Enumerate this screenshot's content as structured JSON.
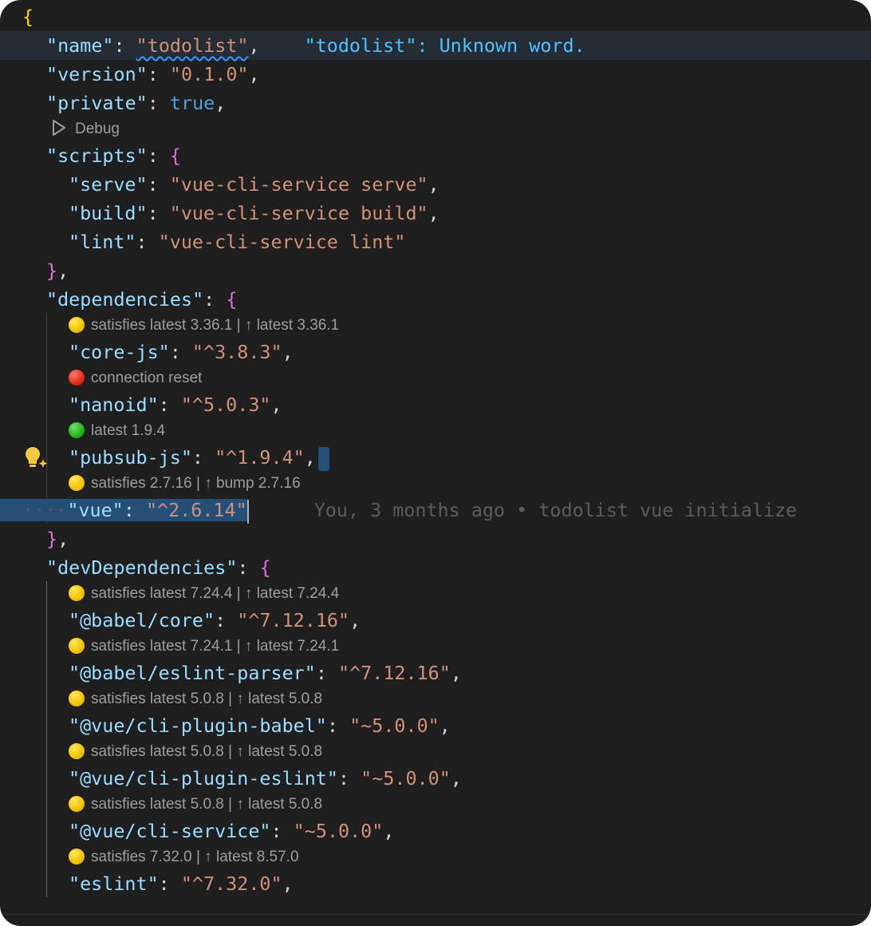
{
  "editor": {
    "open_brace": "{",
    "name_key": "\"name\"",
    "name_value": "\"todolist\"",
    "diagnostic": "\"todolist\": Unknown word.",
    "version_key": "\"version\"",
    "version_value": "\"0.1.0\"",
    "private_key": "\"private\"",
    "private_value": "true",
    "debug_lens": "Debug",
    "scripts_key": "\"scripts\"",
    "scripts": [
      {
        "key": "\"serve\"",
        "value": "\"vue-cli-service serve\""
      },
      {
        "key": "\"build\"",
        "value": "\"vue-cli-service build\""
      },
      {
        "key": "\"lint\"",
        "value": "\"vue-cli-service lint\""
      }
    ],
    "dependencies_key": "\"dependencies\"",
    "dependencies": [
      {
        "lens": "satisfies latest 3.36.1 | ↑ latest 3.36.1",
        "status": "yellow",
        "key": "\"core-js\"",
        "value": "\"^3.8.3\""
      },
      {
        "lens": "connection reset",
        "status": "red",
        "key": "\"nanoid\"",
        "value": "\"^5.0.3\""
      },
      {
        "lens": "latest 1.9.4",
        "status": "green",
        "key": "\"pubsub-js\"",
        "value": "\"^1.9.4\""
      },
      {
        "lens": "satisfies 2.7.16 | ↑ bump 2.7.16",
        "status": "yellow",
        "key": "\"vue\"",
        "value": "\"^2.6.14\""
      }
    ],
    "blame": "You, 3 months ago • todolist vue initialize",
    "devDependencies_key": "\"devDependencies\"",
    "devDependencies": [
      {
        "lens": "satisfies latest 7.24.4 | ↑ latest 7.24.4",
        "status": "yellow",
        "key": "\"@babel/core\"",
        "value": "\"^7.12.16\""
      },
      {
        "lens": "satisfies latest 7.24.1 | ↑ latest 7.24.1",
        "status": "yellow",
        "key": "\"@babel/eslint-parser\"",
        "value": "\"^7.12.16\""
      },
      {
        "lens": "satisfies latest 5.0.8 | ↑ latest 5.0.8",
        "status": "yellow",
        "key": "\"@vue/cli-plugin-babel\"",
        "value": "\"~5.0.0\""
      },
      {
        "lens": "satisfies latest 5.0.8 | ↑ latest 5.0.8",
        "status": "yellow",
        "key": "\"@vue/cli-plugin-eslint\"",
        "value": "\"~5.0.0\""
      },
      {
        "lens": "satisfies latest 5.0.8 | ↑ latest 5.0.8",
        "status": "yellow",
        "key": "\"@vue/cli-service\"",
        "value": "\"~5.0.0\""
      },
      {
        "lens": "satisfies 7.32.0 | ↑ latest 8.57.0",
        "status": "yellow",
        "key": "\"eslint\"",
        "value": "\"^7.32.0\""
      }
    ]
  }
}
